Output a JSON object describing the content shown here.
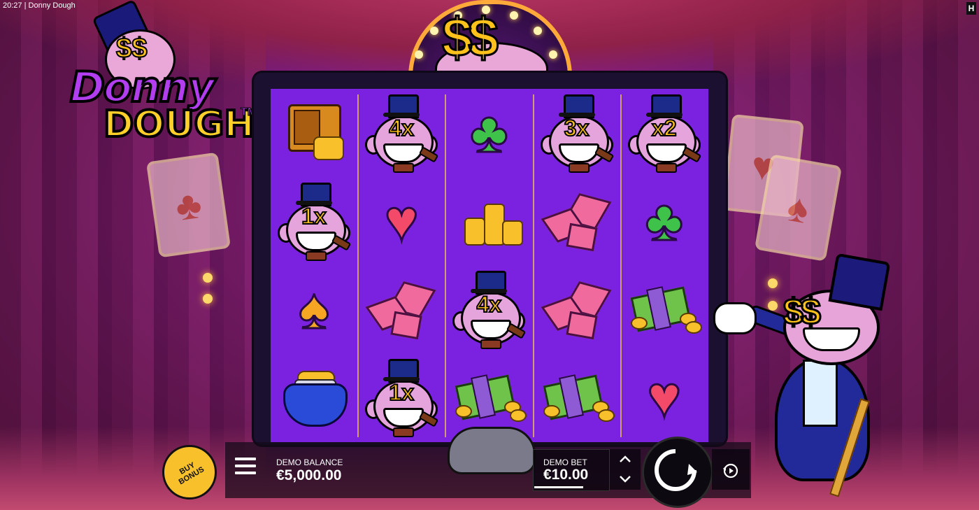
{
  "status_bar": {
    "time": "20:27",
    "separator": "|",
    "title": "Donny Dough"
  },
  "corner_logo": "H",
  "game_logo": {
    "line1": "Donny",
    "line2": "DOUGH",
    "trademark": "TM",
    "eyes": "$$"
  },
  "marquee": {
    "dollars": "$$"
  },
  "reels": [
    [
      {
        "symbol": "safe-icon"
      },
      {
        "symbol": "multiplier-face",
        "label": "1x"
      },
      {
        "symbol": "spade-icon",
        "glyph": "♠"
      },
      {
        "symbol": "purse-icon"
      }
    ],
    [
      {
        "symbol": "multiplier-face",
        "label": "4x"
      },
      {
        "symbol": "heart-icon",
        "glyph": "♥"
      },
      {
        "symbol": "gem-icon"
      },
      {
        "symbol": "multiplier-face",
        "label": "1x"
      }
    ],
    [
      {
        "symbol": "club-icon",
        "glyph": "♣"
      },
      {
        "symbol": "coins-icon"
      },
      {
        "symbol": "multiplier-face",
        "label": "4x"
      },
      {
        "symbol": "cash-icon"
      }
    ],
    [
      {
        "symbol": "multiplier-face",
        "label": "3x"
      },
      {
        "symbol": "gem-icon"
      },
      {
        "symbol": "gem-icon"
      },
      {
        "symbol": "cash-icon"
      }
    ],
    [
      {
        "symbol": "multiplier-face",
        "label": "x2"
      },
      {
        "symbol": "club-icon",
        "glyph": "♣"
      },
      {
        "symbol": "cash-icon"
      },
      {
        "symbol": "heart-icon",
        "glyph": "♥"
      }
    ]
  ],
  "host": {
    "eyes": "$$"
  },
  "hud": {
    "buy_bonus": "BUY\nBONUS",
    "balance_label": "DEMO BALANCE",
    "balance_value": "€5,000.00",
    "bet_label": "DEMO BET",
    "bet_value": "€10.00",
    "arrow_up": "⌃",
    "arrow_down": "⌄"
  },
  "colors": {
    "reel_bg": "#7a22e0",
    "gold": "#ffc21a",
    "separator": "#e3b25a",
    "bonus": "#f8c02b"
  }
}
